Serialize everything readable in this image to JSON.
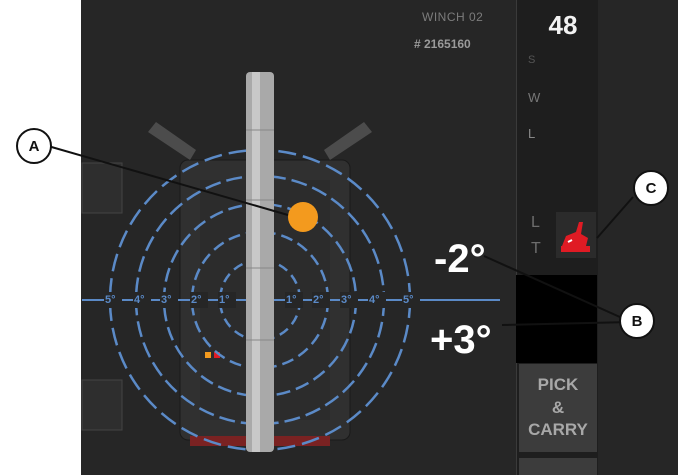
{
  "header": {
    "winch_title": "WINCH 02",
    "winch_id": "# 2165160",
    "count": "48"
  },
  "side_gauge": {
    "labels": [
      "S",
      "W",
      "L"
    ]
  },
  "lt_panel": {
    "l_label": "L",
    "t_label": "T",
    "alert_icon": "warning-crane-icon"
  },
  "angles": {
    "top": "-2°",
    "bottom": "+3°"
  },
  "rings": {
    "labels": [
      "5°",
      "4°",
      "3°",
      "2°",
      "1°",
      "1°",
      "2°",
      "3°",
      "4°",
      "5°"
    ]
  },
  "buttons": {
    "pick_carry_line1": "PICK",
    "pick_carry_line2": "&",
    "pick_carry_line3": "CARRY"
  },
  "callouts": {
    "a": "A",
    "b": "B",
    "c": "C"
  },
  "colors": {
    "ring": "#5b8ac7",
    "bubble": "#f39a1e",
    "alert": "#e01b24",
    "background": "#262626"
  }
}
